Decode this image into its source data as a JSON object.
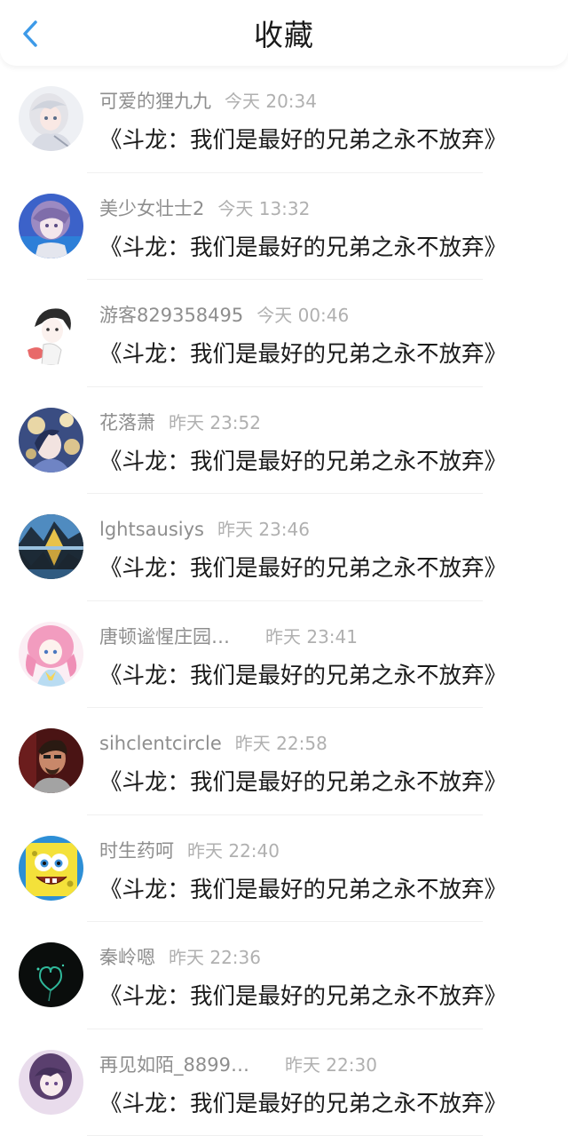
{
  "header": {
    "title": "收藏",
    "back_icon": "chevron-left-icon",
    "accent_color": "#3d9ae8"
  },
  "items": [
    {
      "user": "可爱的狸九九",
      "time": "今天 20:34",
      "title": "《斗龙：我们是最好的兄弟之永不放弃》",
      "avatar_icon": "anime-girl-white-hair-avatar"
    },
    {
      "user": "美少女壮士2",
      "time": "今天 13:32",
      "title": "《斗龙：我们是最好的兄弟之永不放弃》",
      "avatar_icon": "anime-boy-purple-hair-avatar"
    },
    {
      "user": "游客829358495",
      "time": "今天 00:46",
      "title": "《斗龙：我们是最好的兄弟之永不放弃》",
      "avatar_icon": "anime-girl-sketch-avatar"
    },
    {
      "user": "花落萧",
      "time": "昨天 23:52",
      "title": "《斗龙：我们是最好的兄弟之永不放弃》",
      "avatar_icon": "anime-girl-flowers-avatar"
    },
    {
      "user": "lghtsausiys",
      "time": "昨天 23:46",
      "title": "《斗龙：我们是最好的兄弟之永不放弃》",
      "avatar_icon": "mountain-lake-avatar"
    },
    {
      "user": "唐顿谧惺庄园…",
      "time": "昨天 23:41",
      "title": "《斗龙：我们是最好的兄弟之永不放弃》",
      "avatar_icon": "anime-pink-hair-avatar"
    },
    {
      "user": "sihclentcircle",
      "time": "昨天 22:58",
      "title": "《斗龙：我们是最好的兄弟之永不放弃》",
      "avatar_icon": "man-portrait-avatar"
    },
    {
      "user": "时生药呵",
      "time": "昨天 22:40",
      "title": "《斗龙：我们是最好的兄弟之永不放弃》",
      "avatar_icon": "spongebob-avatar"
    },
    {
      "user": "秦岭嗯",
      "time": "昨天 22:36",
      "title": "《斗龙：我们是最好的兄弟之永不放弃》",
      "avatar_icon": "dark-glow-avatar"
    },
    {
      "user": "再见如陌_8899…",
      "time": "昨天 22:30",
      "title": "《斗龙：我们是最好的兄弟之永不放弃》",
      "avatar_icon": "anime-girl-dark-hair-avatar"
    }
  ]
}
